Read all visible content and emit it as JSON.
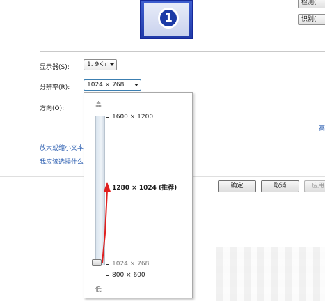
{
  "side_buttons": {
    "detect": "检测(",
    "identify": "识别("
  },
  "display": {
    "label": "显示器(S):",
    "value": "1. 9Klr"
  },
  "resolution": {
    "label": "分辨率(R):",
    "value": "1024 × 768",
    "slider": {
      "high_label": "高",
      "low_label": "低",
      "options": [
        "1600 × 1200",
        "1280 × 1024 (推荐)",
        "1024 × 768",
        "800 × 600"
      ],
      "selected": "1024 × 768"
    }
  },
  "orientation": {
    "label": "方向(O):"
  },
  "links": {
    "enlarge": "放大或缩小文本",
    "choose": "我应该选择什么",
    "advanced": "高"
  },
  "buttons": {
    "ok": "确定",
    "cancel": "取消",
    "apply": "应用"
  },
  "monitor_number": "1",
  "annotation": {
    "color": "#e02020"
  }
}
